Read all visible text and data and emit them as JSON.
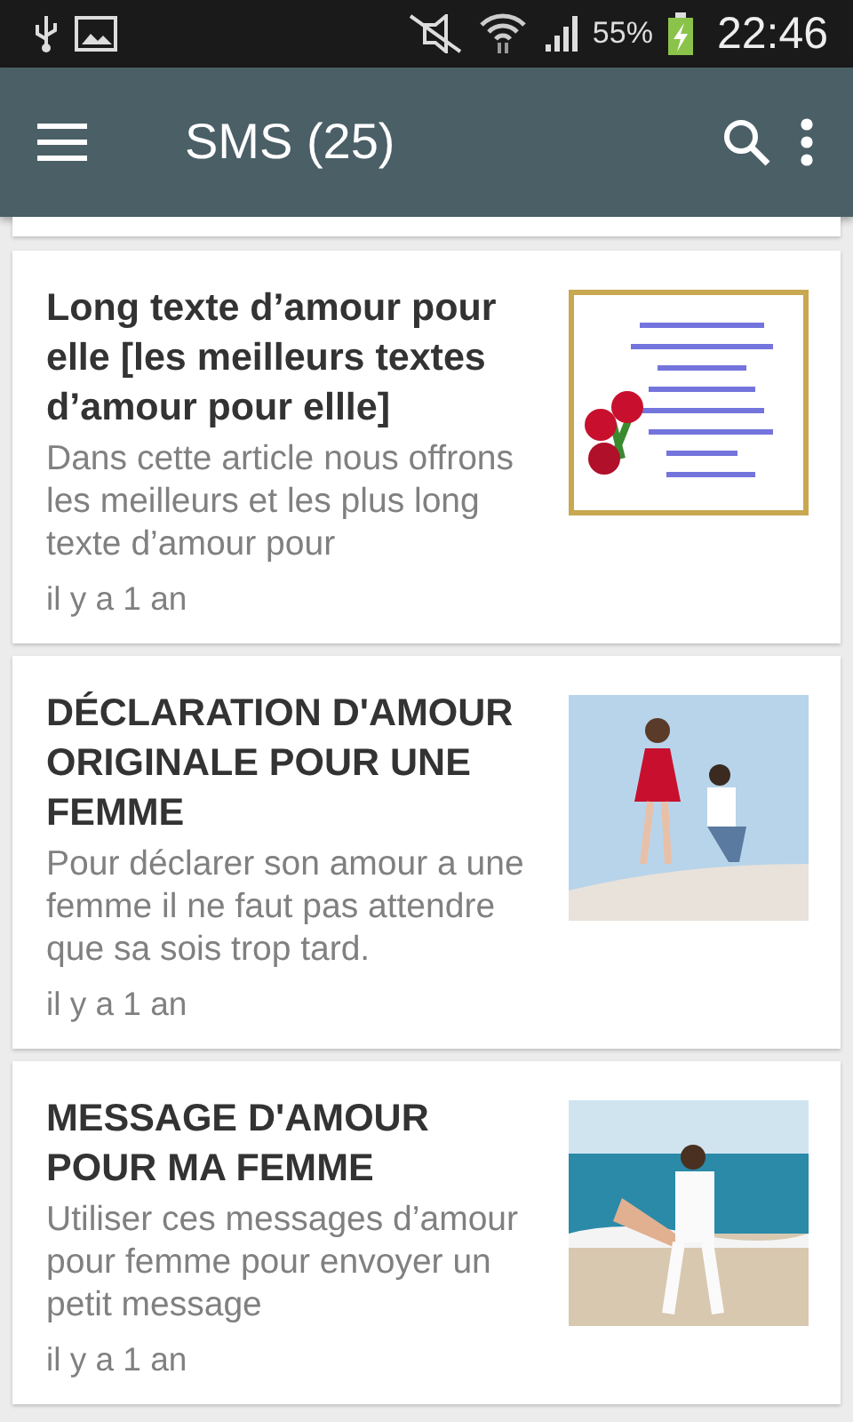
{
  "status_bar": {
    "battery": "55%",
    "time": "22:46"
  },
  "toolbar": {
    "title": "SMS (25)"
  },
  "articles": [
    {
      "title": "Long texte d’amour pour elle [les meilleurs textes d’amour pour ellle]",
      "excerpt": "Dans cette article nous offrons les meilleurs et les plus long texte d’amour pour",
      "age": "il y a 1 an"
    },
    {
      "title": "DÉCLARATION D'AMOUR ORIGINALE POUR UNE FEMME",
      "excerpt": "Pour déclarer son amour a une femme il ne faut pas attendre que sa sois trop tard.",
      "age": "il y a 1 an"
    },
    {
      "title": "MESSAGE D'AMOUR POUR MA FEMME",
      "excerpt": "Utiliser ces messages d’amour pour femme pour envoyer un petit message",
      "age": "il y a 1 an"
    }
  ]
}
